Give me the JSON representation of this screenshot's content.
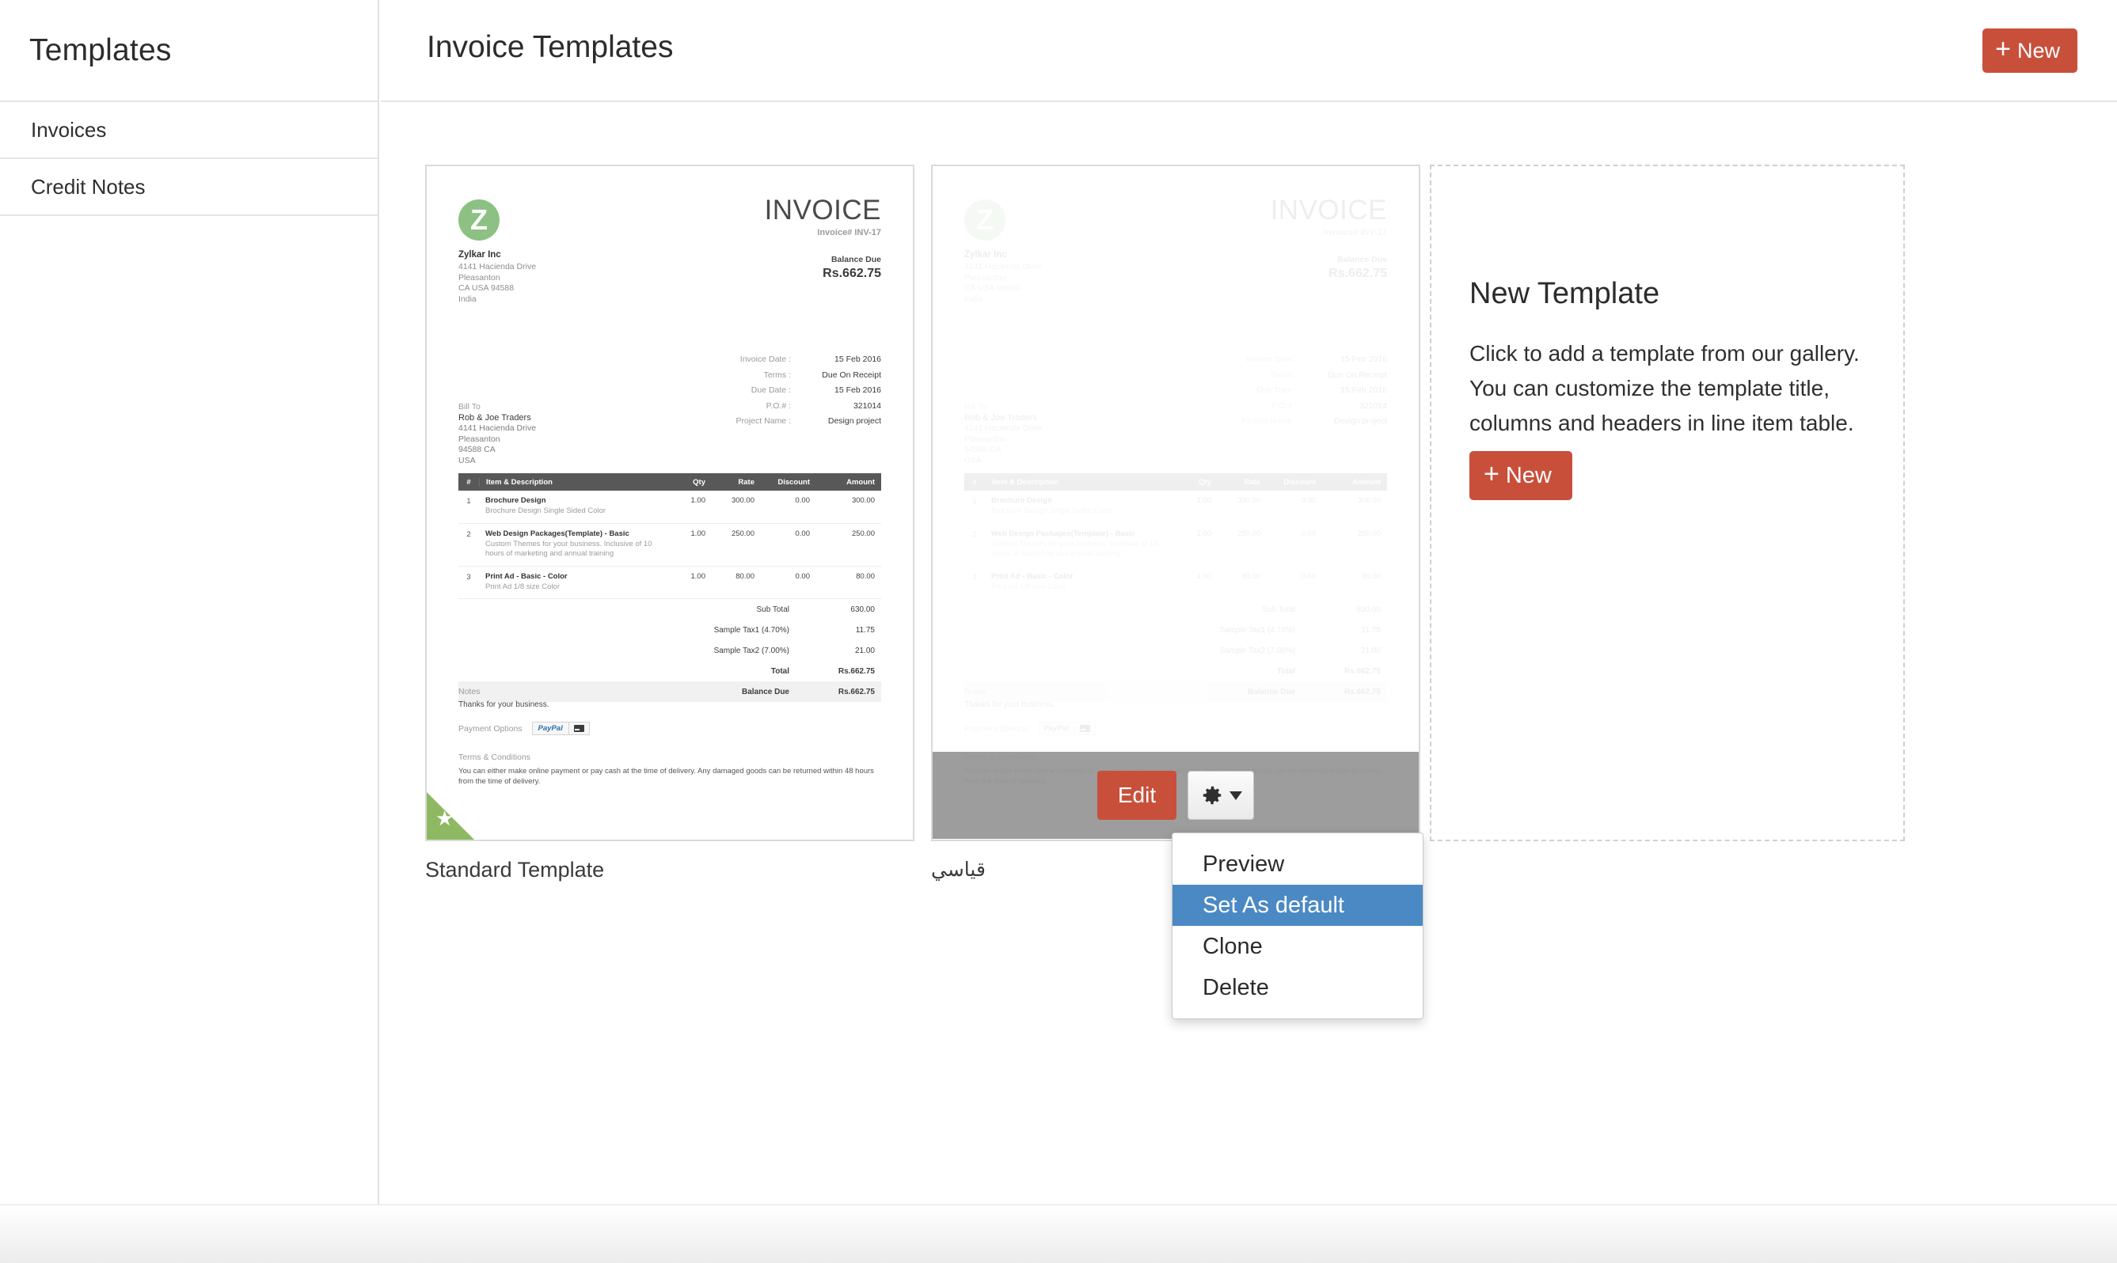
{
  "sidebar": {
    "title": "Templates",
    "items": [
      {
        "label": "Invoices"
      },
      {
        "label": "Credit Notes"
      }
    ]
  },
  "header": {
    "page_title": "Invoice Templates",
    "new_button": "New",
    "plus": "+"
  },
  "colors": {
    "accent_red": "#c8503b",
    "accent_blue": "#4b89c4",
    "logo_green": "#8cc183",
    "badge_green": "#8fb862",
    "table_header_gray": "#585858"
  },
  "templates": [
    {
      "label": "Standard Template",
      "is_default": true
    },
    {
      "label": "قياسي",
      "is_default": false
    }
  ],
  "invoice_preview": {
    "logo_letter": "Z",
    "org_name": "Zylkar Inc",
    "org_address": "4141 Hacienda Drive\nPleasanton\nCA USA 94588\nIndia",
    "doc_word": "INVOICE",
    "invoice_number": "Invoice# INV-17",
    "balance_due_label": "Balance Due",
    "balance_due_value": "Rs.662.75",
    "bill_to_label": "Bill To",
    "bill_to_name": "Rob & Joe Traders",
    "bill_to_address": "4141 Hacienda Drive\nPleasanton\n94588 CA\nUSA",
    "meta": [
      {
        "key": "Invoice Date :",
        "value": "15 Feb 2016"
      },
      {
        "key": "Terms :",
        "value": "Due On Receipt"
      },
      {
        "key": "Due Date :",
        "value": "15 Feb 2016"
      },
      {
        "key": "P.O.# :",
        "value": "321014"
      },
      {
        "key": "Project Name :",
        "value": "Design project"
      }
    ],
    "columns": [
      "#",
      "Item & Description",
      "Qty",
      "Rate",
      "Discount",
      "Amount"
    ],
    "line_items": [
      {
        "no": "1",
        "name": "Brochure Design",
        "desc": "Brochure Design Single Sided Color",
        "qty": "1.00",
        "rate": "300.00",
        "discount": "0.00",
        "amount": "300.00"
      },
      {
        "no": "2",
        "name": "Web Design Packages(Template) - Basic",
        "desc": "Custom Themes for your business. Inclusive of 10 hours of marketing and annual training",
        "qty": "1.00",
        "rate": "250.00",
        "discount": "0.00",
        "amount": "250.00"
      },
      {
        "no": "3",
        "name": "Print Ad - Basic - Color",
        "desc": "Print Ad 1/8 size Color",
        "qty": "1.00",
        "rate": "80.00",
        "discount": "0.00",
        "amount": "80.00"
      }
    ],
    "totals": [
      {
        "label": "Sub Total",
        "value": "630.00",
        "style": "normal"
      },
      {
        "label": "Sample Tax1 (4.70%)",
        "value": "11.75",
        "style": "normal"
      },
      {
        "label": "Sample Tax2 (7.00%)",
        "value": "21.00",
        "style": "normal"
      },
      {
        "label": "Total",
        "value": "Rs.662.75",
        "style": "grand"
      },
      {
        "label": "Balance Due",
        "value": "Rs.662.75",
        "style": "balance"
      }
    ],
    "notes_label": "Notes",
    "notes_text": "Thanks for your business.",
    "payment_options_label": "Payment Options",
    "paypal_label": "PayPal",
    "terms_label": "Terms & Conditions",
    "terms_text": "You can either make online payment or pay cash at the time of delivery. Any damaged goods can be returned within 48 hours from the time of delivery."
  },
  "hover_actions": {
    "edit_label": "Edit",
    "gear_icon": "gear-icon"
  },
  "dropdown": {
    "items": [
      {
        "label": "Preview",
        "selected": false
      },
      {
        "label": "Set As default",
        "selected": true
      },
      {
        "label": "Clone",
        "selected": false
      },
      {
        "label": "Delete",
        "selected": false
      }
    ]
  },
  "new_template_panel": {
    "title": "New Template",
    "description": "Click to add a template from our gallery. You can customize the template title, columns and headers in line item table.",
    "new_button": "New",
    "plus": "+"
  }
}
